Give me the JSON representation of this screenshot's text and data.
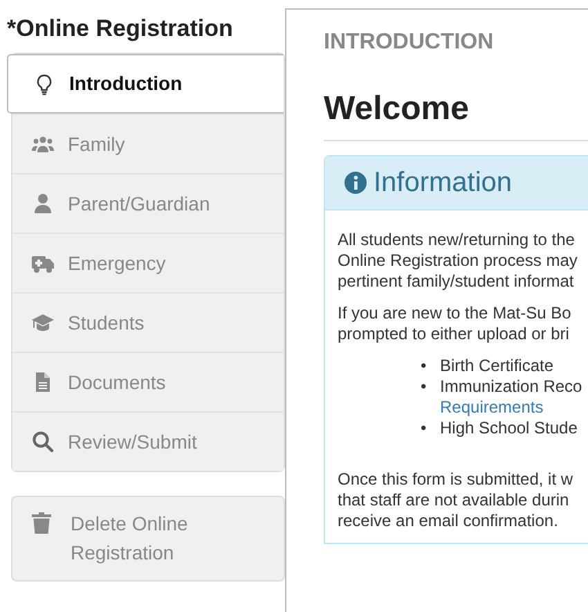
{
  "sidebar": {
    "title": "*Online Registration",
    "items": [
      {
        "label": "Introduction",
        "selected": true
      },
      {
        "label": "Family",
        "selected": false
      },
      {
        "label": "Parent/Guardian",
        "selected": false
      },
      {
        "label": "Emergency",
        "selected": false
      },
      {
        "label": "Students",
        "selected": false
      },
      {
        "label": "Documents",
        "selected": false
      },
      {
        "label": "Review/Submit",
        "selected": false
      }
    ],
    "delete_button": "Delete Online Registration"
  },
  "main": {
    "section_title": "INTRODUCTION",
    "heading": "Welcome",
    "info_panel": {
      "title": "Information",
      "paragraph_1": [
        "All students new/returning to the",
        "Online Registration process may",
        "pertinent family/student informat"
      ],
      "paragraph_2": [
        "If you are new to the Mat-Su Bo",
        "prompted to either upload or bri"
      ],
      "list": [
        {
          "bullet": "•",
          "lines": [
            "Birth Certificate"
          ]
        },
        {
          "bullet": "•",
          "lines": [
            "Immunization Reco"
          ],
          "link": "Requirements"
        },
        {
          "bullet": "•",
          "lines": [
            "High School Stude"
          ]
        }
      ],
      "paragraph_3": [
        "Once this form is submitted, it w",
        "that staff are not available durin",
        "receive an email confirmation."
      ]
    }
  }
}
